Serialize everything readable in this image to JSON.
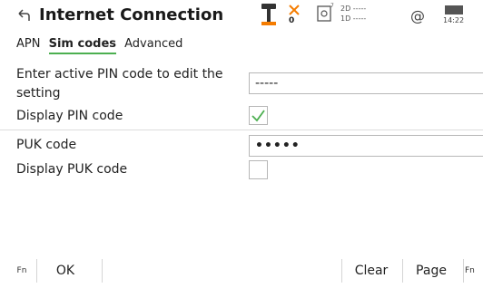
{
  "header": {
    "title": "Internet Connection",
    "status": {
      "satellite_count": "0",
      "position_2d": "2D -----",
      "position_1d": "1D -----",
      "clock": "14:22"
    }
  },
  "tabs": [
    {
      "label": "APN",
      "active": false
    },
    {
      "label": "Sim codes",
      "active": true
    },
    {
      "label": "Advanced",
      "active": false
    }
  ],
  "form": {
    "active_pin_label": "Enter active PIN code to edit the setting",
    "active_pin_value": "-----",
    "display_pin_label": "Display PIN code",
    "display_pin_checked": true,
    "puk_label": "PUK code",
    "puk_value": "•••••",
    "display_puk_label": "Display PUK code",
    "display_puk_checked": false
  },
  "bottom_bar": {
    "fn_left": "Fn",
    "ok": "OK",
    "clear": "Clear",
    "page": "Page",
    "fn_right": "Fn"
  },
  "colors": {
    "accent": "#4caf50",
    "warning": "#f57c00"
  }
}
